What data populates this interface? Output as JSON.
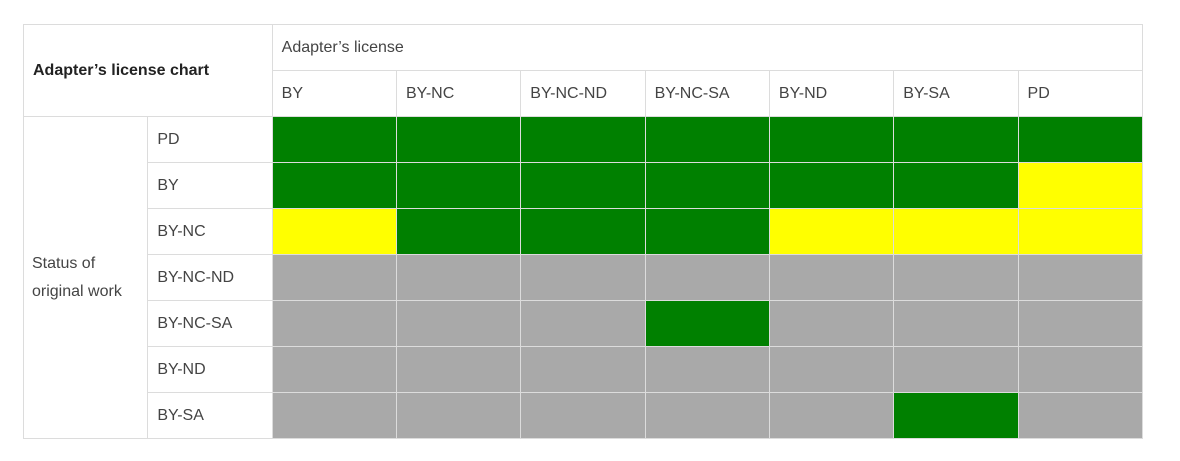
{
  "title": "Adapter’s license chart",
  "adapter_header": "Adapter’s license",
  "row_group_label": "Status of original work",
  "columns": [
    "BY",
    "BY-NC",
    "BY-NC-ND",
    "BY-NC-SA",
    "BY-ND",
    "BY-SA",
    "PD"
  ],
  "rows": [
    {
      "label": "PD",
      "cells": [
        "compatible",
        "compatible",
        "compatible",
        "compatible",
        "compatible",
        "compatible",
        "compatible"
      ]
    },
    {
      "label": "BY",
      "cells": [
        "compatible",
        "compatible",
        "compatible",
        "compatible",
        "compatible",
        "compatible",
        "partial"
      ]
    },
    {
      "label": "BY-NC",
      "cells": [
        "partial",
        "compatible",
        "compatible",
        "compatible",
        "partial",
        "partial",
        "partial"
      ]
    },
    {
      "label": "BY-NC-ND",
      "cells": [
        "incompatible",
        "incompatible",
        "incompatible",
        "incompatible",
        "incompatible",
        "incompatible",
        "incompatible"
      ]
    },
    {
      "label": "BY-NC-SA",
      "cells": [
        "incompatible",
        "incompatible",
        "incompatible",
        "compatible",
        "incompatible",
        "incompatible",
        "incompatible"
      ]
    },
    {
      "label": "BY-ND",
      "cells": [
        "incompatible",
        "incompatible",
        "incompatible",
        "incompatible",
        "incompatible",
        "incompatible",
        "incompatible"
      ]
    },
    {
      "label": "BY-SA",
      "cells": [
        "incompatible",
        "incompatible",
        "incompatible",
        "incompatible",
        "incompatible",
        "compatible",
        "incompatible"
      ]
    }
  ],
  "colors": {
    "compatible": "#008000",
    "partial": "#ffff00",
    "incompatible": "#a9a9a9"
  }
}
